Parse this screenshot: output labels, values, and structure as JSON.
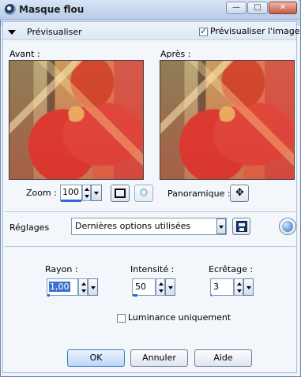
{
  "window": {
    "title": "Masque flou"
  },
  "header": {
    "preview_toggle_label": "Prévisualiser",
    "preview_image_label": "Prévisualiser l'image",
    "preview_image_checked": true
  },
  "previews": {
    "before_label": "Avant :",
    "after_label": "Après :"
  },
  "zoom": {
    "label": "Zoom :",
    "value": "100"
  },
  "panoramique": {
    "label": "Panoramique :"
  },
  "presets": {
    "label": "Réglages",
    "value": "Dernières options utilisées"
  },
  "params": {
    "rayon": {
      "label": "Rayon :",
      "value": "1,00"
    },
    "intensite": {
      "label": "Intensité :",
      "value": "50"
    },
    "ecretage": {
      "label": "Ecrêtage :",
      "value": "3"
    }
  },
  "luminance": {
    "label": "Luminance uniquement",
    "checked": false
  },
  "buttons": {
    "ok": "OK",
    "cancel": "Annuler",
    "help": "Aide"
  },
  "colors": {
    "accent": "#2f6ad6",
    "title_bg": "#c9daf0",
    "panel_bg": "#f3f6fb"
  },
  "icons": {
    "app": "app-icon",
    "minimize": "minimize-icon",
    "maximize": "maximize-icon",
    "close": "close-icon"
  }
}
